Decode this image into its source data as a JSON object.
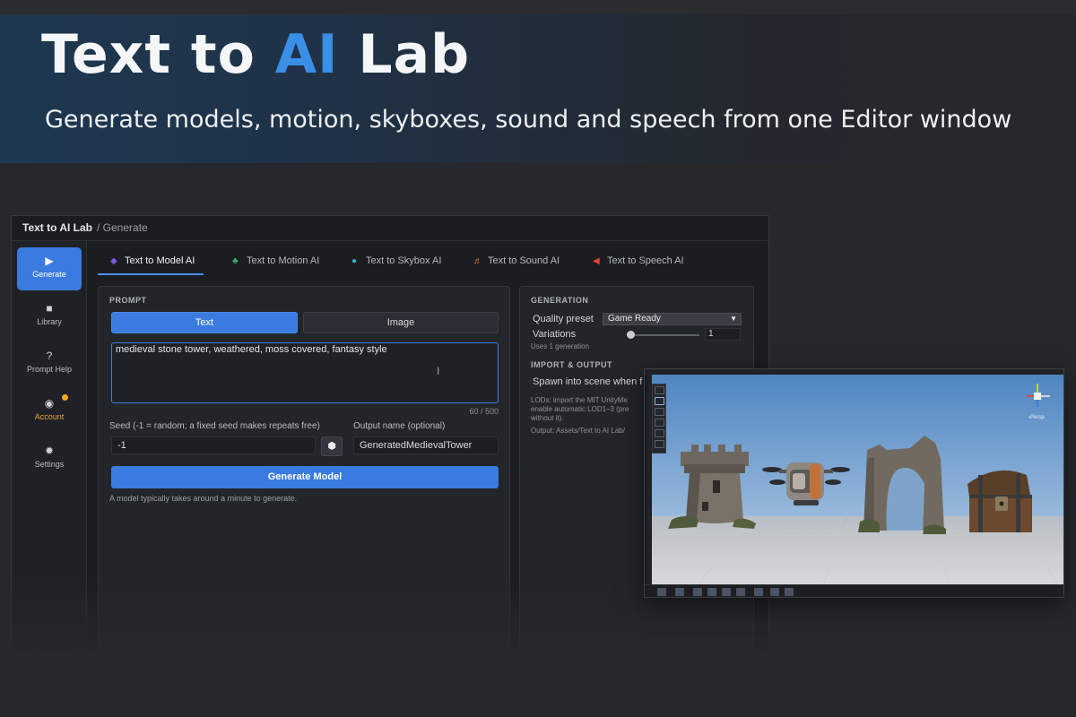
{
  "hero": {
    "title_part1": "Text to ",
    "title_accent": "AI",
    "title_part2": " Lab",
    "subtitle": "Generate models, motion, skyboxes, sound and speech from one Editor window",
    "accent_color": "#3b8fe6"
  },
  "window": {
    "app_title": "Text to AI Lab",
    "breadcrumb": "/ Generate"
  },
  "sidebar": {
    "items": [
      {
        "label": "Generate",
        "icon": "play-icon",
        "glyph": "▶"
      },
      {
        "label": "Library",
        "icon": "folder-icon",
        "glyph": "■"
      },
      {
        "label": "Prompt Help",
        "icon": "help-icon",
        "glyph": "?"
      },
      {
        "label": "Account",
        "icon": "eye-icon",
        "glyph": "◉"
      },
      {
        "label": "Settings",
        "icon": "gear-icon",
        "glyph": "✹"
      }
    ]
  },
  "tabs": [
    {
      "label": "Text to Model AI",
      "glyph": "◆",
      "color": "#7c5ce0"
    },
    {
      "label": "Text to Motion AI",
      "glyph": "♣",
      "color": "#3fb36a"
    },
    {
      "label": "Text to Skybox AI",
      "glyph": "●",
      "color": "#2fb4c8"
    },
    {
      "label": "Text to Sound AI",
      "glyph": "♬",
      "color": "#e8763a"
    },
    {
      "label": "Text to Speech AI",
      "glyph": "◀",
      "color": "#e0453a"
    }
  ],
  "prompt": {
    "section_title": "PROMPT",
    "mode_text": "Text",
    "mode_image": "Image",
    "value": "medieval stone tower, weathered, moss covered, fantasy style",
    "counter": "60 / 500",
    "seed_label": "Seed (-1 = random; a fixed seed makes repeats free)",
    "seed_value": "-1",
    "output_label": "Output name (optional)",
    "output_value": "GeneratedMedievalTower",
    "generate_button": "Generate Model",
    "hint": "A model typically takes around a minute to generate."
  },
  "generation": {
    "section_title": "GENERATION",
    "quality_label": "Quality preset",
    "quality_value": "Game Ready",
    "variations_label": "Variations",
    "variations_value": "1",
    "variations_note": "Uses 1 generation",
    "import_title": "IMPORT & OUTPUT",
    "spawn_label": "Spawn into scene when f",
    "lods_line1": "LODs: import the MIT UnityMe",
    "lods_line2": "enable automatic LOD1–3 (pre",
    "lods_line3": "without it).",
    "output_path": "Output: Assets/Text to AI Lab/"
  },
  "scene": {
    "gizmo_label": "‹Persp",
    "colors": {
      "sky_top": "#4f86c2",
      "sky_bottom": "#c6d8ea",
      "ground": "#c9cdd2"
    }
  }
}
